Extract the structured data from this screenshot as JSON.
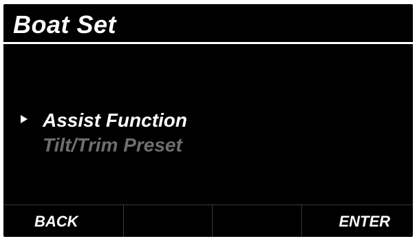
{
  "header": {
    "title": "Boat Set"
  },
  "menu": {
    "items": [
      {
        "label": "Assist Function",
        "selected": true
      },
      {
        "label": "Tilt/Trim Preset",
        "selected": false
      }
    ]
  },
  "softkeys": {
    "key1": "BACK",
    "key2": "",
    "key3": "",
    "key4": "ENTER"
  },
  "colors": {
    "background": "#000000",
    "text": "#ffffff",
    "dimmed_text": "#6e6e6e",
    "divider": "#ffffff",
    "softkey_separator": "#3a3a3a"
  },
  "icons": {
    "cursor": "right-triangle-cursor-icon"
  }
}
